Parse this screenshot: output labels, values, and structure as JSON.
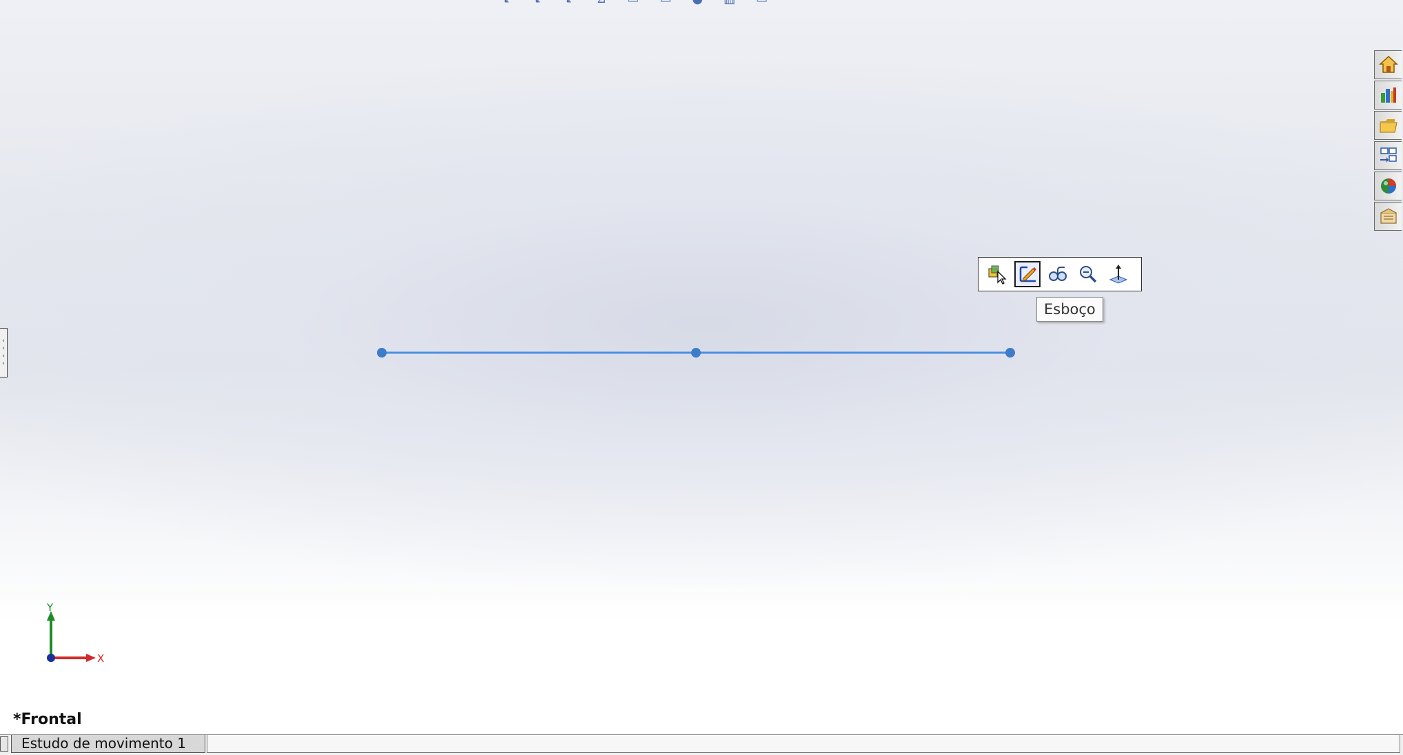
{
  "context_toolbar": {
    "buttons": [
      {
        "icon": "select-component-icon",
        "active": false
      },
      {
        "icon": "edit-sketch-icon",
        "active": true
      },
      {
        "icon": "hide-show-icon",
        "active": false
      },
      {
        "icon": "zoom-to-selection-icon",
        "active": false
      },
      {
        "icon": "normal-to-icon",
        "active": false
      }
    ],
    "tooltip": "Esboço"
  },
  "task_pane": {
    "tabs": [
      {
        "icon": "home-icon"
      },
      {
        "icon": "design-library-icon"
      },
      {
        "icon": "file-explorer-icon"
      },
      {
        "icon": "view-palette-icon"
      },
      {
        "icon": "appearances-icon"
      },
      {
        "icon": "custom-properties-icon"
      }
    ]
  },
  "sketch": {
    "color": "#4a90e2",
    "point_color": "#3d7cc9"
  },
  "triad": {
    "x_label": "X",
    "y_label": "Y"
  },
  "view": {
    "orientation_label": "*Frontal"
  },
  "bottom_tabs": {
    "motion_study": "Estudo de movimento 1"
  }
}
